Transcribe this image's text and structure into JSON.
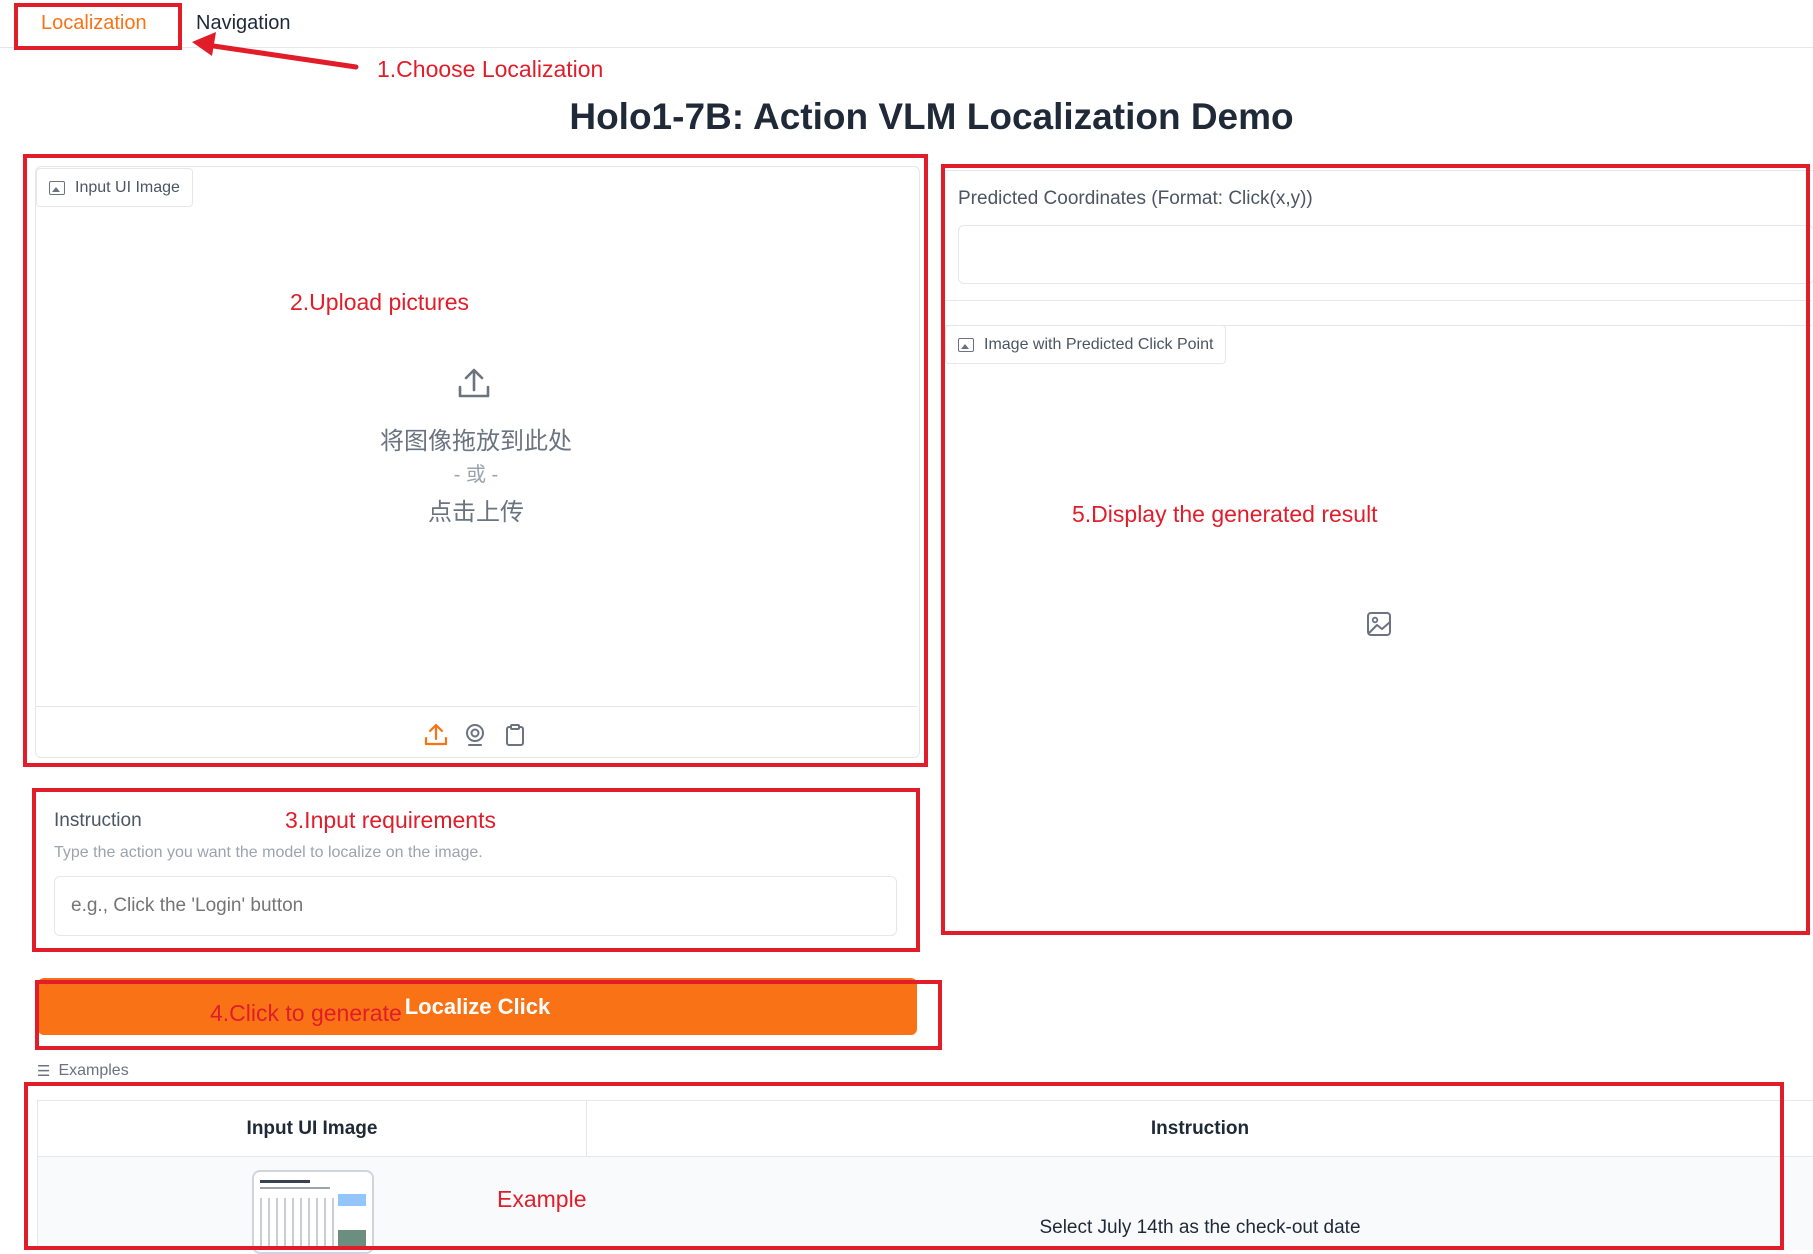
{
  "tabs": [
    {
      "label": "Localization",
      "active": true
    },
    {
      "label": "Navigation",
      "active": false
    }
  ],
  "page_title": "Holo1-7B: Action VLM Localization Demo",
  "input_panel": {
    "label": "Input UI Image",
    "drop_text": "将图像拖放到此处",
    "or_text": "- 或 -",
    "click_text": "点击上传",
    "toolbar_icons": [
      "upload-icon",
      "webcam-icon",
      "clipboard-icon"
    ]
  },
  "instruction": {
    "label": "Instruction",
    "help": "Type the action you want the model to localize on the image.",
    "placeholder": "e.g., Click the 'Login' button"
  },
  "submit_button": {
    "label": "Localize Click"
  },
  "output": {
    "coords_label": "Predicted Coordinates (Format: Click(x,y))",
    "coords_value": "",
    "image_label": "Image with Predicted Click Point"
  },
  "examples": {
    "label": "Examples",
    "columns": [
      "Input UI Image",
      "Instruction"
    ],
    "rows": [
      {
        "instruction": "Select July 14th as the check-out date"
      }
    ]
  },
  "annotations": {
    "step1": "1.Choose Localization",
    "step2": "2.Upload pictures",
    "step3": "3.Input requirements",
    "step4": "4.Click to generate",
    "step5": "5.Display the generated result",
    "example": "Example"
  },
  "colors": {
    "accent": "#f97316",
    "annotation": "#e11d2a"
  }
}
